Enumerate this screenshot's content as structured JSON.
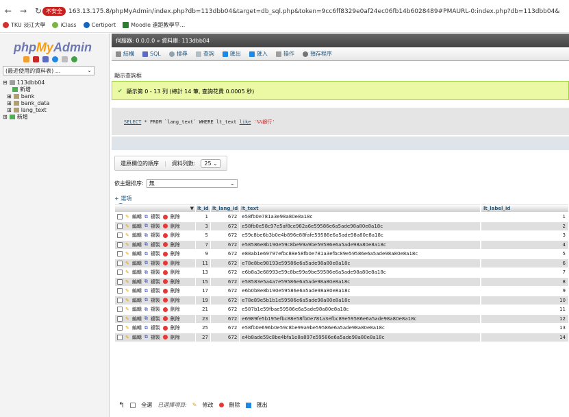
{
  "browser": {
    "url": "163.13.175.8/phpMyAdmin/index.php?db=113dbb04&target=db_sql.php&token=9cc6ff8329e0af24ec06fb14b6028489#PMAURL-0:index.php?db=113dbb04&",
    "insecure_label": "不安全",
    "bookmarks": [
      "TKU 淡江大學",
      "iClass",
      "Certiport",
      "Moodle 遠距教學平..."
    ]
  },
  "left": {
    "logo_php": "php",
    "logo_my": "My",
    "logo_admin": "Admin",
    "recent_label": "(最近使用的資料表) ...",
    "tree": {
      "db": "113dbb04",
      "new1": "新增",
      "bank": "bank",
      "bank_data": "bank_data",
      "lang_text": "lang_text",
      "new2": "新增"
    }
  },
  "main": {
    "breadcrumb": "伺服器: 0.0.0.0 » 資料庫: 113dbb04",
    "tabs": [
      "結構",
      "SQL",
      "搜尋",
      "查詢",
      "匯出",
      "匯入",
      "操作",
      "預存程序"
    ],
    "show_query": "顯示查詢框",
    "success": "顯示第 0 - 13 列 (總計 14 筆, 查詢花費 0.0005 秒)",
    "sql": {
      "select": "SELECT",
      "mid": " * FROM `lang_text` WHERE lt_text ",
      "like": "like",
      "str": " '%%銀行'"
    },
    "nav": {
      "restore_cols": "還原欄位的順序",
      "rows_label": "資料列數:",
      "rows_value": "25"
    },
    "sort": {
      "label": "依主鍵排序:",
      "value": "無"
    },
    "options": {
      "plus": "+ 選項",
      "arrows": "←T→"
    },
    "table": {
      "headers": [
        "lt_id",
        "lt_lang_id",
        "lt_text",
        "lt_label_id"
      ],
      "actions": {
        "edit": "編輯",
        "copy": "複製",
        "delete": "刪除"
      },
      "rows": [
        [
          "1",
          "672",
          "e58fb0e781a3e98a80e8a18c",
          "1"
        ],
        [
          "3",
          "672",
          "e58fb0e58c97e5af8ce982a6e59586e6a5ade98a80e8a18c",
          "2"
        ],
        [
          "5",
          "672",
          "e59c8be6b3b0e4b896e88fafe59586e6a5ade98a80e8a18c",
          "3"
        ],
        [
          "7",
          "672",
          "e58586e8b190e59c8be99a9be59586e6a5ade98a80e8a18c",
          "4"
        ],
        [
          "9",
          "672",
          "e88ab1e69797efbc88e58fb0e781a3efbc89e59586e6a5ade98a80e8a18c",
          "5"
        ],
        [
          "11",
          "672",
          "e78e8be98193e59586e6a5ade98a80e8a18c",
          "6"
        ],
        [
          "13",
          "672",
          "e6b8a3e68993e59c8be99a9be59586e6a5ade98a80e8a18c",
          "7"
        ],
        [
          "15",
          "672",
          "e58583e5a4a7e59586e6a5ade98a80e8a18c",
          "8"
        ],
        [
          "17",
          "672",
          "e6b0b8e8b190e59586e6a5ade98a80e8a18c",
          "9"
        ],
        [
          "19",
          "672",
          "e78e89e5b1b1e59586e6a5ade98a80e8a18c",
          "10"
        ],
        [
          "21",
          "672",
          "e587b1e59fbae59586e6a5ade98a80e8a18c",
          "11"
        ],
        [
          "23",
          "672",
          "e6989fe5b195efbc88e58fb0e781a3efbc89e59586e6a5ade98a80e8a18c",
          "12"
        ],
        [
          "25",
          "672",
          "e58fb0e696b0e59c8be99a9be59586e6a5ade98a80e8a18c",
          "13"
        ],
        [
          "27",
          "672",
          "e4b8ade59c8be4bfa1e8a897e59586e6a5ade98a80e8a18c",
          "14"
        ]
      ]
    },
    "bulk": {
      "check_all": "全選",
      "selected": "已選擇項目:",
      "edit": "修改",
      "delete": "刪除",
      "export": "匯出"
    }
  }
}
